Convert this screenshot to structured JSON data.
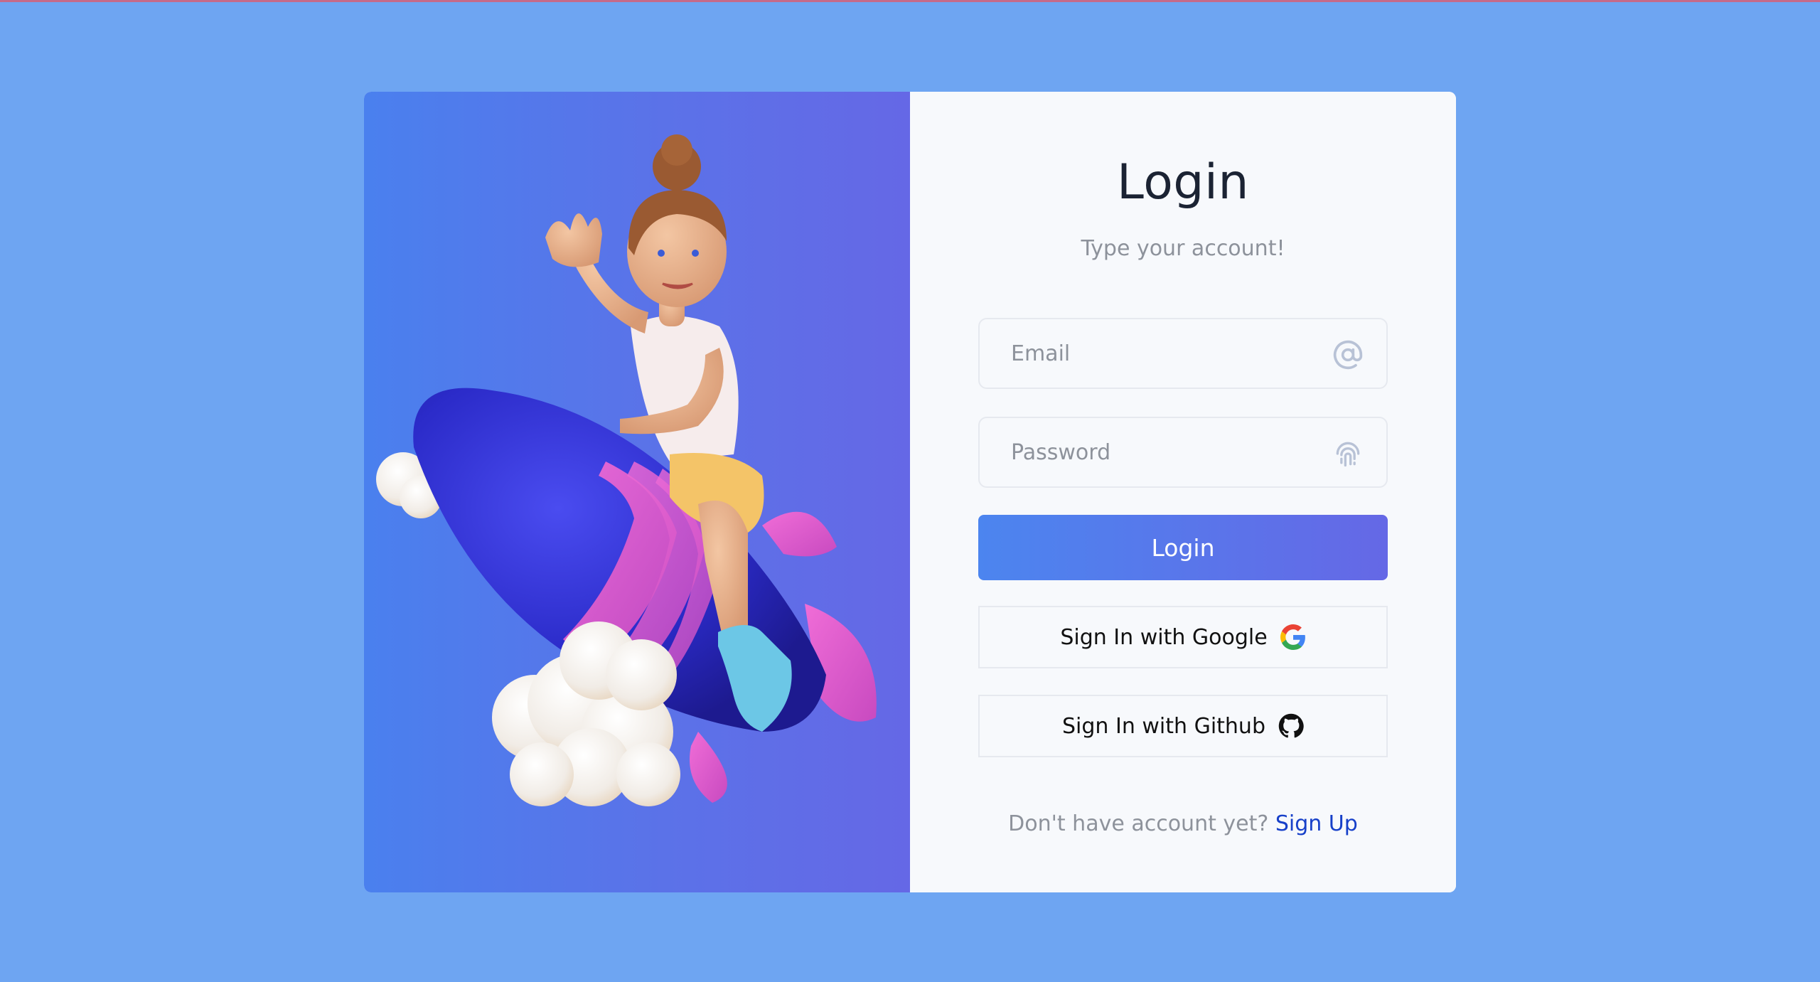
{
  "login": {
    "title": "Login",
    "subtitle": "Type your account!",
    "email_placeholder": "Email",
    "password_placeholder": "Password",
    "login_button": "Login",
    "google_button": "Sign In with Google",
    "github_button": "Sign In with Github",
    "footer_text": "Don't have account yet?",
    "signup_link": "Sign Up"
  },
  "icons": {
    "email": "at-sign-icon",
    "password": "fingerprint-icon",
    "google": "google-icon",
    "github": "github-icon"
  },
  "colors": {
    "page_background": "#6ea5f2",
    "panel_gradient_start": "#4a80ee",
    "panel_gradient_end": "#6568e6",
    "button_gradient_start": "#4c85ef",
    "button_gradient_end": "#6568e6",
    "link": "#1740c9",
    "muted_text": "#8d929b",
    "title_text": "#1b2333"
  }
}
